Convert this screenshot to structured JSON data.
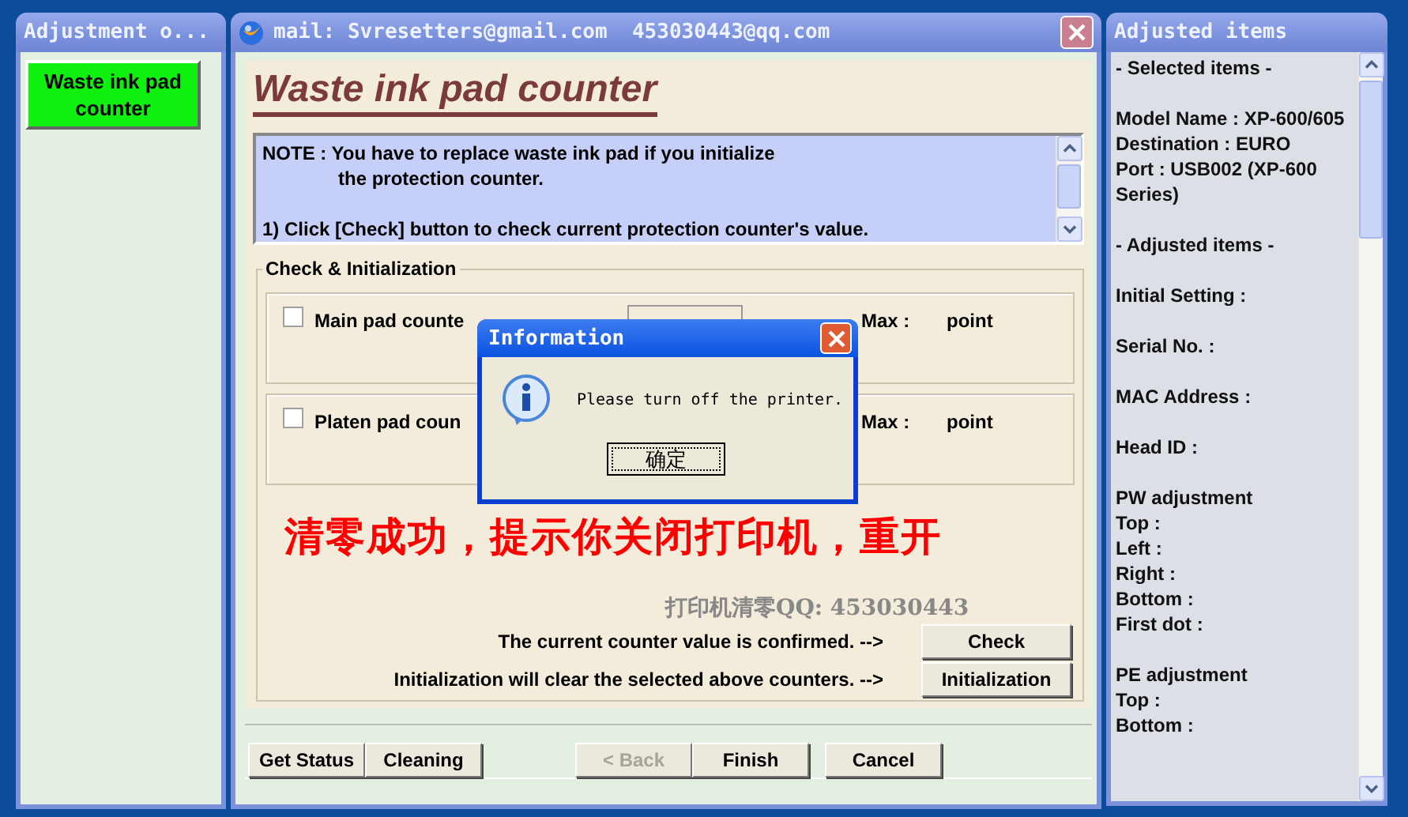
{
  "left_window": {
    "title": "Adjustment o...",
    "items": [
      {
        "label": "Waste ink pad counter",
        "selected": true
      }
    ]
  },
  "main_window": {
    "title": "mail: Svresetters@gmail.com  453030443@qq.com",
    "heading": "Waste ink pad counter",
    "note": [
      {
        "kind": "text",
        "text": "NOTE : You have to replace waste ink pad if you initialize"
      },
      {
        "kind": "indent",
        "text": "the protection counter."
      },
      {
        "kind": "paragraph",
        "text": "1) Click [Check] button to check current protection counter's value."
      }
    ],
    "group": {
      "title": "Check & Initialization",
      "counters": [
        {
          "label": "Main pad counte",
          "checked": false,
          "field": true,
          "max_label": "Max :",
          "unit": "point"
        },
        {
          "label": "Platen pad coun",
          "checked": false,
          "field": false,
          "max_label": "Max :",
          "unit": "point"
        }
      ],
      "annotation": "清零成功，提示你关闭打印机，重开",
      "caption": "打印机清零QQ: 453030443",
      "actions": [
        {
          "text": "The current counter value is confirmed. -->",
          "button": "Check"
        },
        {
          "text": "Initialization will clear the selected above counters. -->",
          "button": "Initialization"
        }
      ]
    },
    "buttons": [
      {
        "label": "Get Status",
        "disabled": false
      },
      {
        "label": "Cleaning",
        "disabled": false
      },
      {
        "label": "< Back",
        "disabled": true
      },
      {
        "label": "Finish",
        "disabled": false
      },
      {
        "label": "Cancel",
        "disabled": false
      }
    ]
  },
  "dialog": {
    "title": "Information",
    "message": "Please turn off the printer.",
    "button": "确定"
  },
  "right_window": {
    "title": "Adjusted items",
    "groups": [
      [
        "- Selected items -"
      ],
      [
        "Model Name : XP-600/605",
        "Destination : EURO",
        "Port : USB002 (XP-600 Series)"
      ],
      [
        "- Adjusted items -"
      ],
      [
        "Initial Setting :"
      ],
      [
        "Serial No. :"
      ],
      [
        "MAC Address :"
      ],
      [
        "Head ID :"
      ],
      [
        "PW adjustment",
        "Top :",
        "Left :",
        "Right :",
        "Bottom :",
        "First dot :"
      ],
      [
        "PE adjustment",
        "Top :",
        "Bottom :"
      ]
    ]
  }
}
